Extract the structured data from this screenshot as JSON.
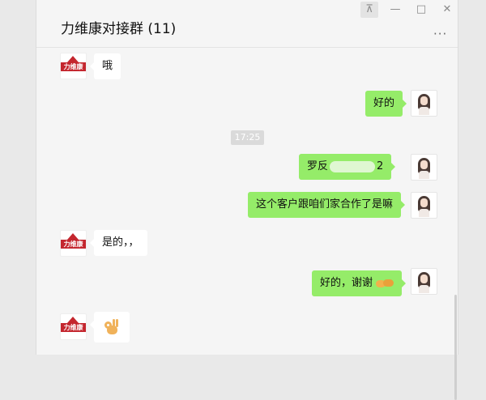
{
  "window": {
    "title": "力维康对接群 (11)",
    "controls": {
      "pin": "⊼",
      "minimize": "—",
      "maximize": "□",
      "close": "✕"
    },
    "more": "···"
  },
  "chat": {
    "messages": [
      {
        "side": "in",
        "text": "哦"
      },
      {
        "side": "out",
        "text": "好的"
      },
      {
        "side": "out",
        "text_start": "罗反",
        "text_end": "2"
      },
      {
        "side": "out",
        "text": "这个客户跟咱们家合作了是嘛"
      },
      {
        "side": "in",
        "text": "是的，，"
      },
      {
        "side": "out",
        "text": "好的，谢谢"
      },
      {
        "side": "in",
        "text": ""
      }
    ],
    "timestamp": "17:25",
    "brand_avatar_text": "力维康"
  },
  "colors": {
    "outgoing_bubble": "#95ec69",
    "incoming_bubble": "#ffffff",
    "brand_red": "#c4262e"
  },
  "icons": [
    "pin-icon",
    "minimize-icon",
    "maximize-icon",
    "close-icon",
    "more-icon",
    "handshake-emoji",
    "ok-hand-emoji"
  ]
}
